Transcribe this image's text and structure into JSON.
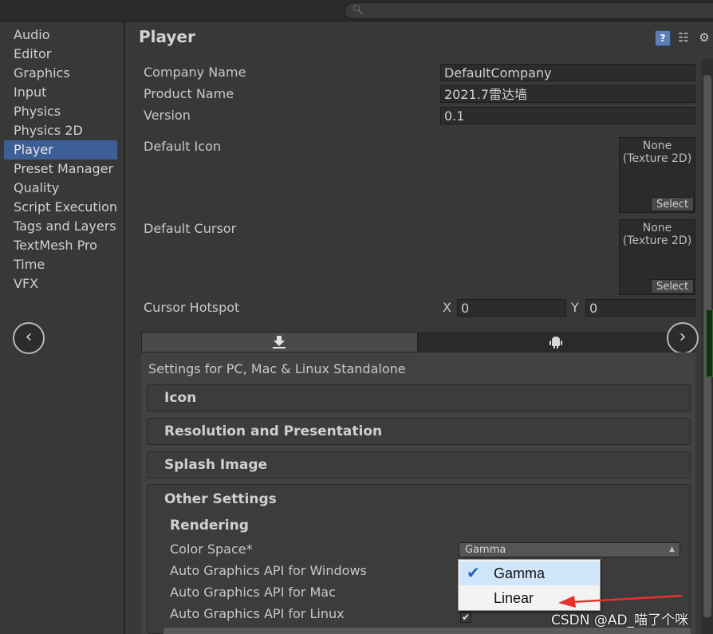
{
  "search": {
    "icon": "search-icon"
  },
  "sidebar": {
    "items": [
      "Audio",
      "Editor",
      "Graphics",
      "Input",
      "Physics",
      "Physics 2D",
      "Player",
      "Preset Manager",
      "Quality",
      "Script Execution Order",
      "Tags and Layers",
      "TextMesh Pro",
      "Time",
      "VFX"
    ],
    "selected": "Player"
  },
  "header": {
    "title": "Player",
    "icons": [
      "help-icon",
      "preset-icon",
      "gear-icon"
    ]
  },
  "player": {
    "company_name_label": "Company Name",
    "company_name": "DefaultCompany",
    "product_name_label": "Product Name",
    "product_name": "2021.7雷达墙",
    "version_label": "Version",
    "version": "0.1",
    "default_icon_label": "Default Icon",
    "default_cursor_label": "Default Cursor",
    "texture_none": "None",
    "texture_type": "(Texture 2D)",
    "select_label": "Select",
    "cursor_hotspot_label": "Cursor Hotspot",
    "hotspot_x_label": "X",
    "hotspot_x": "0",
    "hotspot_y_label": "Y",
    "hotspot_y": "0"
  },
  "platform_tabs": {
    "icons": [
      "download-icon",
      "android-icon"
    ]
  },
  "settings_for": "Settings for PC, Mac & Linux Standalone",
  "sections": {
    "icon": "Icon",
    "resolution": "Resolution and Presentation",
    "splash": "Splash Image",
    "other": "Other Settings"
  },
  "rendering": {
    "title": "Rendering",
    "color_space_label": "Color Space*",
    "color_space_value": "Gamma",
    "auto_windows": "Auto Graphics API  for Windows",
    "auto_mac": "Auto Graphics API  for Mac",
    "auto_linux": "Auto Graphics API  for Linux",
    "auto_linux_checked": true
  },
  "dropdown": {
    "options": [
      "Gamma",
      "Linear"
    ],
    "selected": "Gamma",
    "arrow_color": "#e8322c"
  },
  "watermark": "CSDN @AD_喵了个咪"
}
